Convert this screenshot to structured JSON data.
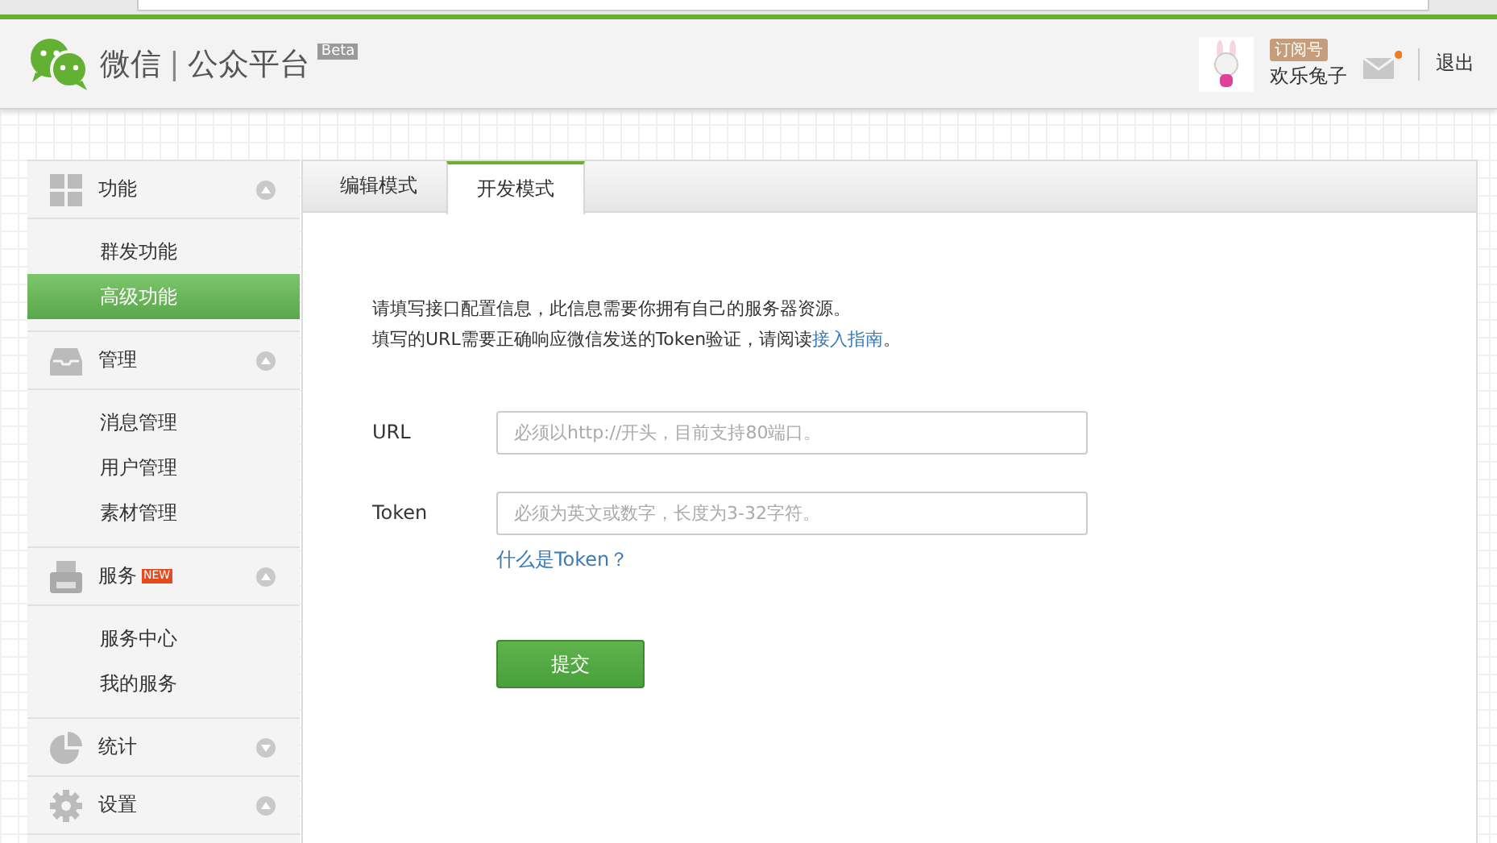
{
  "header": {
    "brand": "微信",
    "separator": "|",
    "subtitle": "公众平台",
    "badge": "Beta",
    "account_type": "订阅号",
    "account_name": "欢乐兔子",
    "mail_unread": true,
    "logout": "退出"
  },
  "sidebar": {
    "groups": [
      {
        "label": "功能",
        "expanded": true,
        "items": [
          {
            "label": "群发功能",
            "selected": false
          },
          {
            "label": "高级功能",
            "selected": true
          }
        ]
      },
      {
        "label": "管理",
        "expanded": true,
        "items": [
          {
            "label": "消息管理",
            "selected": false
          },
          {
            "label": "用户管理",
            "selected": false
          },
          {
            "label": "素材管理",
            "selected": false
          }
        ]
      },
      {
        "label": "服务",
        "badge": "NEW",
        "expanded": true,
        "items": [
          {
            "label": "服务中心",
            "selected": false
          },
          {
            "label": "我的服务",
            "selected": false
          }
        ]
      },
      {
        "label": "统计",
        "expanded": false
      },
      {
        "label": "设置",
        "expanded": true
      }
    ]
  },
  "tabs": [
    {
      "label": "编辑模式",
      "selected": false
    },
    {
      "label": "开发模式",
      "selected": true
    }
  ],
  "intro": [
    {
      "text": "请填写接口配置信息，此信息需要你拥有自己的服务器资源。"
    },
    {
      "text": "填写的URL需要正确响应微信发送的Token验证，请阅读",
      "link": "接入指南",
      "after": "。"
    }
  ],
  "fields": [
    {
      "label": "URL",
      "placeholder": "必须以http://开头，目前支持80端口。"
    },
    {
      "label": "Token",
      "placeholder": "必须为英文或数字，长度为3-32字符。",
      "help_link": "什么是Token？"
    }
  ],
  "submit": "提交"
}
